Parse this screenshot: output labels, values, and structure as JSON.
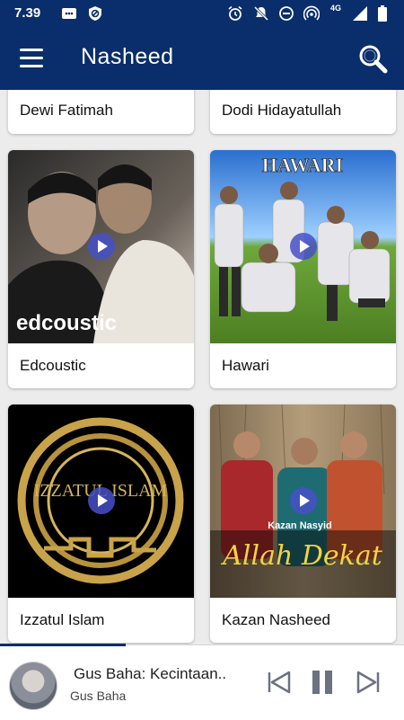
{
  "status": {
    "time": "7.39",
    "network": "4G"
  },
  "appbar": {
    "title": "Nasheed"
  },
  "artists": [
    {
      "name": "Dewi Fatimah"
    },
    {
      "name": "Dodi Hidayatullah"
    },
    {
      "name": "Edcoustic",
      "cover_text": "edcoustic"
    },
    {
      "name": "Hawari",
      "cover_text": "HAWARI"
    },
    {
      "name": "Izzatul Islam",
      "cover_text": "IZZATUL ISLAM"
    },
    {
      "name": "Kazan Nasheed",
      "cover_text": "Kazan Nasyid",
      "cover_script": "Allah Dekat"
    }
  ],
  "player": {
    "title": "Gus Baha: Kecintaan..",
    "artist": "Gus Baha",
    "progress": 0.31
  },
  "colors": {
    "primary": "#0a2e6b",
    "play_accent": "#4650c8"
  }
}
